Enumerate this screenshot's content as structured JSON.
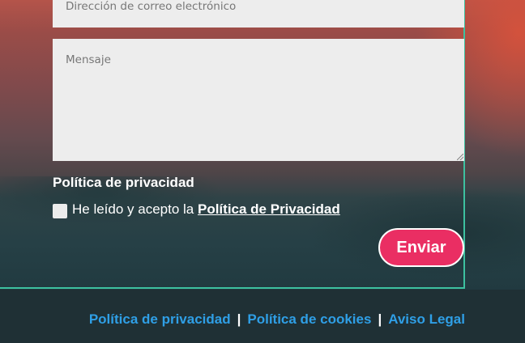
{
  "form": {
    "email_placeholder": "Dirección de correo electrónico",
    "message_placeholder": "Mensaje",
    "privacy_heading": "Política de privacidad",
    "consent_text": "He leído y acepto la ",
    "consent_link": "Política de Privacidad",
    "consent_checked": false,
    "submit_label": "Enviar"
  },
  "footer": {
    "links": [
      "Política de privacidad",
      "Política de cookies",
      "Aviso Legal"
    ],
    "separator": "|"
  },
  "colors": {
    "accent_button": "#ea2e63",
    "frame_border": "#3dc1a0",
    "footer_link": "#2f9fe6"
  }
}
